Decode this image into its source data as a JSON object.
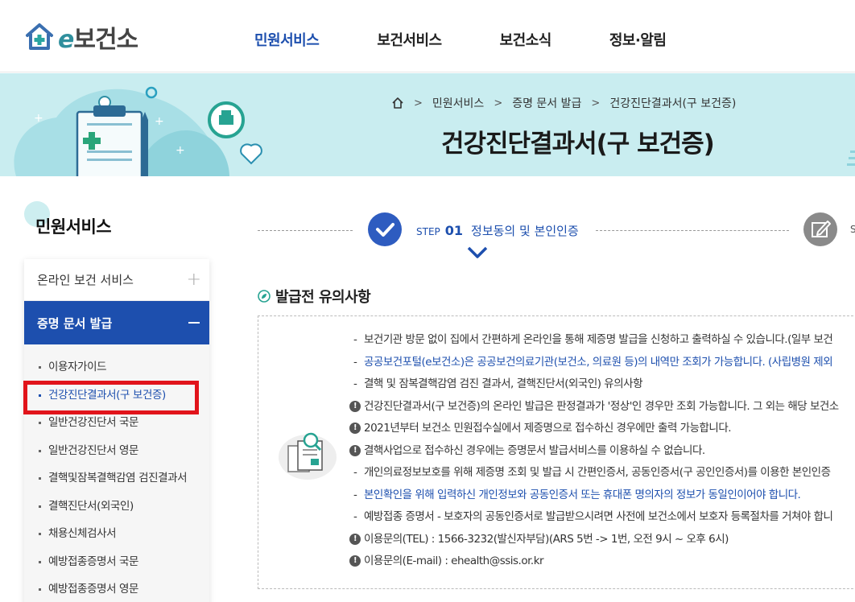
{
  "header": {
    "logo_prefix": "e",
    "logo_text": "보건소",
    "nav": [
      "민원서비스",
      "보건서비스",
      "보건소식",
      "정보·알림"
    ]
  },
  "banner": {
    "breadcrumb": [
      "민원서비스",
      "증명 문서 발급",
      "건강진단결과서(구 보건증)"
    ],
    "page_title": "건강진단결과서(구 보건증)"
  },
  "sidebar": {
    "title": "민원서비스",
    "collapsed_menu": "온라인 보건 서비스",
    "active_menu": "증명 문서 발급",
    "sub_items": [
      "이용자가이드",
      "건강진단결과서(구 보건증)",
      "일반건강진단서 국문",
      "일반건강진단서 영문",
      "결핵및잠복결핵감염 검진결과서",
      "결핵진단서(외국인)",
      "채용신체검사서",
      "예방접종증명서 국문",
      "예방접종증명서 영문"
    ]
  },
  "steps": {
    "step_word": "STEP",
    "step_num": "01",
    "step_desc": "정보동의 및 본인인증",
    "next_step_initial": "S"
  },
  "notice": {
    "title": "발급전 유의사항",
    "items": [
      "보건기관 방문 없이 집에서 간편하게 온라인을 통해 제증명 발급을 신청하고 출력하실 수 있습니다.(일부 보건",
      "공공보건포털(e보건소)은 공공보건의료기관(보건소, 의료원 등)의 내역만 조회가 가능합니다. (사립병원 제외",
      "결핵 및 잠복결핵감염 검진 결과서, 결핵진단서(외국인) 유의사항",
      "건강진단결과서(구 보건증)의 온라인 발급은 판정결과가 '정상'인 경우만 조회 가능합니다. 그 외는 해당 보건소",
      "2021년부터 보건소 민원접수실에서 제증명으로 접수하신 경우에만 출력 가능합니다.",
      "결핵사업으로 접수하신 경우에는 증명문서 발급서비스를 이용하실 수 없습니다.",
      "개인의료정보보호를 위해 제증명 조회 및 발급 시 간편인증서, 공동인증서(구 공인인증서)를 이용한 본인인증",
      "본인확인을 위해 입력하신 개인정보와 공동인증서 또는 휴대폰 명의자의 정보가 동일인이어야 합니다.",
      "예방접종 증명서 - 보호자의 공동인증서로 발급받으시려면 사전에 보건소에서 보호자 등록절차를 거쳐야 합니",
      "이용문의(TEL) : 1566-3232(발신자부담)(ARS 5번 -> 1번, 오전 9시 ~ 오후 6시)",
      "이용문의(E-mail) : ehealth@ssis.or.kr"
    ]
  },
  "colors": {
    "brand_blue": "#1d4fae",
    "banner_bg": "#c9edf0",
    "highlight_red": "#e1141b"
  }
}
